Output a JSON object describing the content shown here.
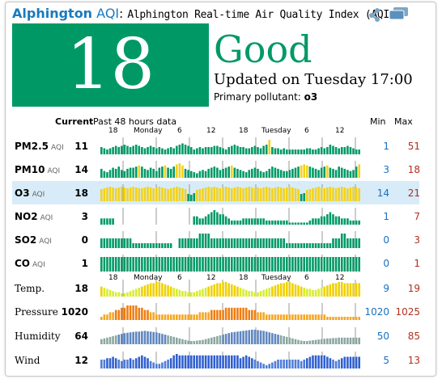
{
  "header": {
    "station": "Alphington",
    "aqi_word": "AQI",
    "colon": ":",
    "description": "Alphington Real-time Air Quality Index (AQI"
  },
  "icons": [
    "share-icon",
    "windows-icon"
  ],
  "summary": {
    "aqi": "18",
    "level": "Good",
    "updated": "Updated on Tuesday 17:00",
    "pollutant_label": "Primary pollutant:",
    "pollutant": "o3"
  },
  "colors": {
    "good": "#009966",
    "link": "#1a7abf",
    "highlight_row": "#d7ecf8",
    "min": "#1a6fbf",
    "max": "#b03020"
  },
  "table": {
    "current_label": "Current",
    "history_label": "Past 48 hours data",
    "min_label": "Min",
    "max_label": "Max",
    "axis_ticks": [
      "18",
      "Monday",
      "6",
      "12",
      "18",
      "Tuesday",
      "6",
      "12"
    ]
  },
  "rows": [
    {
      "name": "PM2.5",
      "sub": "AQI",
      "current": "11",
      "min": "1",
      "max": "51",
      "kind": "aqi",
      "values": [
        6,
        5,
        4,
        5,
        6,
        7,
        6,
        7,
        8,
        7,
        6,
        7,
        8,
        7,
        6,
        5,
        6,
        7,
        6,
        5,
        6,
        5,
        4,
        5,
        6,
        5,
        7,
        8,
        9,
        8,
        7,
        6,
        4,
        5,
        6,
        5,
        6,
        6,
        6,
        7,
        7,
        6,
        5,
        4,
        6,
        7,
        8,
        7,
        6,
        6,
        5,
        5,
        6,
        7,
        6,
        5,
        7,
        8,
        12,
        6,
        5,
        5,
        4,
        5,
        4,
        4,
        4,
        4,
        4,
        4,
        4,
        5,
        5,
        4,
        4,
        5,
        6,
        5,
        6,
        8,
        7,
        6,
        5,
        6,
        6,
        7,
        6,
        5,
        4,
        4
      ]
    },
    {
      "name": "PM10",
      "sub": "AQI",
      "current": "14",
      "min": "3",
      "max": "18",
      "kind": "aqi",
      "values": [
        8,
        6,
        5,
        7,
        9,
        8,
        10,
        7,
        6,
        8,
        9,
        9,
        10,
        11,
        10,
        8,
        7,
        9,
        8,
        6,
        9,
        10,
        11,
        9,
        8,
        10,
        12,
        13,
        11,
        8,
        7,
        6,
        5,
        4,
        6,
        7,
        6,
        8,
        9,
        10,
        9,
        7,
        8,
        9,
        10,
        11,
        9,
        8,
        7,
        6,
        5,
        7,
        8,
        9,
        8,
        6,
        5,
        6,
        8,
        10,
        9,
        8,
        7,
        6,
        6,
        7,
        8,
        9,
        10,
        11,
        12,
        11,
        10,
        9,
        8,
        7,
        9,
        10,
        11,
        9,
        8,
        7,
        10,
        9,
        8,
        7,
        6,
        7,
        10,
        12
      ]
    },
    {
      "name": "O3",
      "sub": "AQI",
      "current": "18",
      "min": "14",
      "max": "21",
      "kind": "aqi",
      "highlight": true,
      "values": [
        15,
        16,
        17,
        18,
        17,
        16,
        17,
        18,
        17,
        16,
        17,
        18,
        17,
        16,
        16,
        17,
        18,
        17,
        16,
        17,
        18,
        17,
        16,
        15,
        16,
        17,
        18,
        17,
        16,
        15,
        9,
        8,
        10,
        14,
        15,
        16,
        17,
        18,
        17,
        18,
        17,
        16,
        17,
        18,
        17,
        16,
        17,
        18,
        17,
        16,
        17,
        18,
        17,
        16,
        17,
        16,
        17,
        18,
        17,
        16,
        17,
        18,
        17,
        16,
        17,
        18,
        17,
        16,
        15,
        9,
        10,
        14,
        15,
        16,
        17,
        18,
        17,
        16,
        17,
        18,
        17,
        16,
        17,
        18,
        17,
        16,
        17,
        18,
        17,
        16
      ]
    },
    {
      "name": "NO2",
      "sub": "AQI",
      "current": "3",
      "min": "1",
      "max": "7",
      "kind": "aqi",
      "values": [
        3,
        3,
        3,
        3,
        3,
        0,
        0,
        0,
        0,
        0,
        0,
        0,
        0,
        0,
        0,
        0,
        0,
        0,
        0,
        0,
        0,
        0,
        0,
        0,
        0,
        0,
        0,
        0,
        0,
        0,
        0,
        0,
        4,
        4,
        3,
        3,
        4,
        5,
        6,
        7,
        6,
        5,
        5,
        4,
        3,
        2,
        2,
        2,
        2,
        3,
        3,
        3,
        3,
        3,
        3,
        3,
        3,
        2,
        2,
        2,
        2,
        2,
        2,
        2,
        2,
        1,
        1,
        1,
        1,
        1,
        1,
        1,
        2,
        3,
        3,
        3,
        4,
        4,
        5,
        6,
        5,
        4,
        4,
        3,
        3,
        3,
        2,
        2,
        2,
        2
      ]
    },
    {
      "name": "SO2",
      "sub": "AQI",
      "current": "0",
      "min": "0",
      "max": "3",
      "kind": "aqi",
      "values": [
        2,
        2,
        2,
        2,
        2,
        2,
        2,
        2,
        2,
        2,
        2,
        1,
        1,
        1,
        1,
        1,
        1,
        1,
        1,
        1,
        1,
        1,
        1,
        1,
        1,
        0,
        0,
        2,
        2,
        2,
        2,
        2,
        2,
        2,
        3,
        3,
        3,
        3,
        2,
        2,
        2,
        2,
        2,
        2,
        2,
        2,
        2,
        2,
        2,
        2,
        2,
        2,
        2,
        2,
        2,
        2,
        2,
        2,
        2,
        2,
        2,
        2,
        2,
        2,
        1,
        1,
        1,
        1,
        1,
        1,
        1,
        1,
        1,
        1,
        1,
        1,
        1,
        1,
        1,
        1,
        2,
        2,
        2,
        3,
        3,
        2,
        2,
        2,
        2,
        2
      ]
    },
    {
      "name": "CO",
      "sub": "AQI",
      "current": "1",
      "min": "0",
      "max": "1",
      "kind": "aqi",
      "values": [
        1,
        1,
        1,
        1,
        1,
        1,
        1,
        1,
        1,
        1,
        1,
        1,
        1,
        1,
        1,
        1,
        1,
        1,
        1,
        1,
        1,
        1,
        1,
        1,
        1,
        1,
        1,
        1,
        1,
        1,
        1,
        1,
        1,
        1,
        1,
        1,
        1,
        1,
        1,
        1,
        1,
        1,
        1,
        1,
        1,
        1,
        1,
        1,
        1,
        1,
        1,
        1,
        1,
        1,
        1,
        1,
        1,
        1,
        1,
        1,
        1,
        1,
        1,
        1,
        1,
        1,
        1,
        1,
        1,
        1,
        1,
        1,
        1,
        1,
        1,
        1,
        1,
        1,
        1,
        1,
        1,
        1,
        1,
        1,
        1,
        1,
        1,
        1,
        1,
        1
      ]
    },
    {
      "name": "Temp.",
      "current": "18",
      "min": "9",
      "max": "19",
      "kind": "temp",
      "values": [
        15,
        14,
        13,
        12,
        11,
        10,
        10,
        9,
        9,
        10,
        11,
        12,
        13,
        14,
        15,
        16,
        17,
        18,
        18,
        19,
        19,
        18,
        17,
        16,
        15,
        14,
        13,
        12,
        11,
        11,
        10,
        10,
        10,
        11,
        12,
        13,
        14,
        15,
        16,
        17,
        18,
        18,
        19,
        19,
        18,
        17,
        16,
        15,
        14,
        13,
        12,
        11,
        11,
        10,
        10,
        11,
        12,
        13,
        14,
        15,
        16,
        17,
        18,
        18,
        19,
        19,
        18,
        17,
        16,
        15,
        14,
        13,
        13,
        12,
        12,
        13,
        14,
        15,
        16,
        17,
        18,
        18,
        19,
        19,
        18,
        18,
        18,
        18,
        18,
        18
      ]
    },
    {
      "name": "Pressure",
      "current": "1020",
      "min": "1020",
      "max": "1025",
      "kind": "pressure",
      "values": [
        1020,
        1021,
        1021,
        1022,
        1022,
        1023,
        1023,
        1024,
        1024,
        1025,
        1025,
        1025,
        1025,
        1024,
        1024,
        1023,
        1023,
        1022,
        1022,
        1021,
        1021,
        1021,
        1021,
        1021,
        1021,
        1021,
        1021,
        1021,
        1021,
        1021,
        1021,
        1021,
        1021,
        1021,
        1022,
        1022,
        1022,
        1022,
        1023,
        1023,
        1023,
        1023,
        1023,
        1024,
        1024,
        1024,
        1024,
        1024,
        1024,
        1024,
        1024,
        1023,
        1023,
        1023,
        1022,
        1022,
        1022,
        1021,
        1021,
        1021,
        1021,
        1021,
        1021,
        1021,
        1021,
        1021,
        1021,
        1021,
        1021,
        1021,
        1021,
        1021,
        1021,
        1021,
        1021,
        1021,
        1021,
        1021,
        1020,
        1020,
        1020,
        1020,
        1020,
        1020,
        1020,
        1020,
        1020,
        1020,
        1020,
        1020
      ]
    },
    {
      "name": "Humidity",
      "current": "64",
      "min": "50",
      "max": "85",
      "kind": "humidity",
      "values": [
        60,
        62,
        64,
        66,
        68,
        70,
        72,
        74,
        76,
        77,
        78,
        79,
        80,
        80,
        81,
        82,
        81,
        80,
        79,
        78,
        76,
        74,
        72,
        70,
        68,
        66,
        64,
        62,
        60,
        58,
        56,
        55,
        55,
        56,
        57,
        58,
        60,
        62,
        64,
        66,
        68,
        70,
        72,
        74,
        76,
        78,
        79,
        80,
        81,
        82,
        83,
        84,
        85,
        85,
        84,
        83,
        82,
        80,
        78,
        76,
        74,
        72,
        70,
        68,
        66,
        64,
        62,
        60,
        58,
        56,
        55,
        55,
        56,
        57,
        58,
        59,
        60,
        61,
        62,
        62,
        63,
        63,
        64,
        64,
        64,
        64,
        64,
        64,
        64,
        64
      ]
    },
    {
      "name": "Wind",
      "current": "12",
      "min": "5",
      "max": "13",
      "kind": "wind",
      "values": [
        9,
        9,
        10,
        10,
        11,
        10,
        9,
        8,
        9,
        9,
        10,
        9,
        10,
        11,
        12,
        11,
        10,
        8,
        7,
        6,
        6,
        7,
        8,
        9,
        10,
        12,
        13,
        12,
        12,
        12,
        12,
        12,
        12,
        12,
        12,
        12,
        12,
        12,
        12,
        12,
        12,
        12,
        12,
        12,
        12,
        12,
        12,
        12,
        10,
        11,
        12,
        11,
        10,
        9,
        8,
        7,
        6,
        5,
        6,
        7,
        8,
        9,
        9,
        9,
        9,
        9,
        9,
        9,
        9,
        8,
        9,
        10,
        11,
        12,
        12,
        12,
        12,
        12,
        11,
        10,
        9,
        8,
        9,
        10,
        11,
        11,
        11,
        11,
        11,
        11
      ]
    }
  ]
}
